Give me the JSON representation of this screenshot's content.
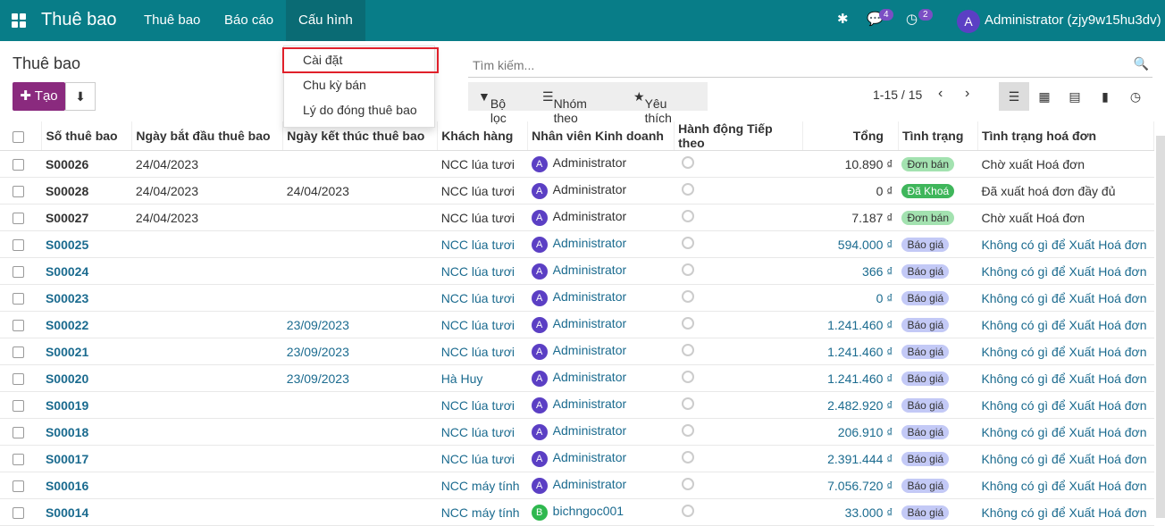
{
  "topbar": {
    "app_title": "Thuê bao",
    "menus": [
      "Thuê bao",
      "Báo cáo",
      "Cấu hình"
    ],
    "chat_count": "4",
    "activity_count": "2",
    "avatar_letter": "A",
    "user": "Administrator (zjy9w15hu3dv)"
  },
  "page": {
    "title": "Thuê bao",
    "create_label": "Tạo",
    "search_placeholder": "Tìm kiếm...",
    "filters": [
      "Bộ lọc",
      "Nhóm theo",
      "Yêu thích"
    ],
    "pager": "1-15 / 15"
  },
  "dropdown": {
    "items": [
      "Cài đặt",
      "Chu kỳ bán",
      "Lý do đóng thuê bao"
    ]
  },
  "table": {
    "headers": [
      "Số thuê bao",
      "Ngày bắt đầu thuê bao",
      "Ngày kết thúc thuê bao",
      "Khách hàng",
      "Nhân viên Kinh doanh",
      "Hành động Tiếp theo",
      "Tổng",
      "Tình trạng",
      "Tình trạng hoá đơn"
    ],
    "rows": [
      {
        "no": "S00026",
        "start": "24/04/2023",
        "end": "",
        "customer": "NCC lúa tươi",
        "av": "A",
        "salesperson": "Administrator",
        "total": "10.890 ₫",
        "status": "Đơn bán",
        "status_type": "sale",
        "invoice": "Chờ xuất Hoá đơn",
        "link": false
      },
      {
        "no": "S00028",
        "start": "24/04/2023",
        "end": "24/04/2023",
        "customer": "NCC lúa tươi",
        "av": "A",
        "salesperson": "Administrator",
        "total": "0 ₫",
        "status": "Đã Khoá",
        "status_type": "lock",
        "invoice": "Đã xuất hoá đơn đầy đủ",
        "link": false
      },
      {
        "no": "S00027",
        "start": "24/04/2023",
        "end": "",
        "customer": "NCC lúa tươi",
        "av": "A",
        "salesperson": "Administrator",
        "total": "7.187 ₫",
        "status": "Đơn bán",
        "status_type": "sale",
        "invoice": "Chờ xuất Hoá đơn",
        "link": false
      },
      {
        "no": "S00025",
        "start": "",
        "end": "",
        "customer": "NCC lúa tươi",
        "av": "A",
        "salesperson": "Administrator",
        "total": "594.000 ₫",
        "status": "Báo giá",
        "status_type": "quote",
        "invoice": "Không có gì để Xuất Hoá đơn",
        "link": true
      },
      {
        "no": "S00024",
        "start": "",
        "end": "",
        "customer": "NCC lúa tươi",
        "av": "A",
        "salesperson": "Administrator",
        "total": "366 ₫",
        "status": "Báo giá",
        "status_type": "quote",
        "invoice": "Không có gì để Xuất Hoá đơn",
        "link": true
      },
      {
        "no": "S00023",
        "start": "",
        "end": "",
        "customer": "NCC lúa tươi",
        "av": "A",
        "salesperson": "Administrator",
        "total": "0 ₫",
        "status": "Báo giá",
        "status_type": "quote",
        "invoice": "Không có gì để Xuất Hoá đơn",
        "link": true
      },
      {
        "no": "S00022",
        "start": "",
        "end": "23/09/2023",
        "customer": "NCC lúa tươi",
        "av": "A",
        "salesperson": "Administrator",
        "total": "1.241.460 ₫",
        "status": "Báo giá",
        "status_type": "quote",
        "invoice": "Không có gì để Xuất Hoá đơn",
        "link": true
      },
      {
        "no": "S00021",
        "start": "",
        "end": "23/09/2023",
        "customer": "NCC lúa tươi",
        "av": "A",
        "salesperson": "Administrator",
        "total": "1.241.460 ₫",
        "status": "Báo giá",
        "status_type": "quote",
        "invoice": "Không có gì để Xuất Hoá đơn",
        "link": true
      },
      {
        "no": "S00020",
        "start": "",
        "end": "23/09/2023",
        "customer": "Hà Huy",
        "av": "A",
        "salesperson": "Administrator",
        "total": "1.241.460 ₫",
        "status": "Báo giá",
        "status_type": "quote",
        "invoice": "Không có gì để Xuất Hoá đơn",
        "link": true
      },
      {
        "no": "S00019",
        "start": "",
        "end": "",
        "customer": "NCC lúa tươi",
        "av": "A",
        "salesperson": "Administrator",
        "total": "2.482.920 ₫",
        "status": "Báo giá",
        "status_type": "quote",
        "invoice": "Không có gì để Xuất Hoá đơn",
        "link": true
      },
      {
        "no": "S00018",
        "start": "",
        "end": "",
        "customer": "NCC lúa tươi",
        "av": "A",
        "salesperson": "Administrator",
        "total": "206.910 ₫",
        "status": "Báo giá",
        "status_type": "quote",
        "invoice": "Không có gì để Xuất Hoá đơn",
        "link": true
      },
      {
        "no": "S00017",
        "start": "",
        "end": "",
        "customer": "NCC lúa tươi",
        "av": "A",
        "salesperson": "Administrator",
        "total": "2.391.444 ₫",
        "status": "Báo giá",
        "status_type": "quote",
        "invoice": "Không có gì để Xuất Hoá đơn",
        "link": true
      },
      {
        "no": "S00016",
        "start": "",
        "end": "",
        "customer": "NCC máy tính",
        "av": "A",
        "salesperson": "Administrator",
        "total": "7.056.720 ₫",
        "status": "Báo giá",
        "status_type": "quote",
        "invoice": "Không có gì để Xuất Hoá đơn",
        "link": true
      },
      {
        "no": "S00014",
        "start": "",
        "end": "",
        "customer": "NCC máy tính",
        "av": "B",
        "salesperson": "bichngoc001",
        "total": "33.000 ₫",
        "status": "Báo giá",
        "status_type": "quote",
        "invoice": "Không có gì để Xuất Hoá đơn",
        "link": true
      }
    ]
  },
  "colors": {
    "brand": "#087d88",
    "create": "#8a2a7e",
    "link": "#1b6b8f",
    "highlight": "#e0202a"
  }
}
